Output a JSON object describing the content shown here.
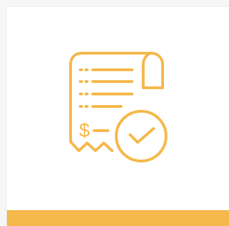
{
  "colors": {
    "accent": "#F5B84A",
    "background": "#F6F6F6",
    "card": "#FFFFFF"
  },
  "icon": {
    "name": "receipt-paid-icon",
    "currency_symbol": "$"
  }
}
